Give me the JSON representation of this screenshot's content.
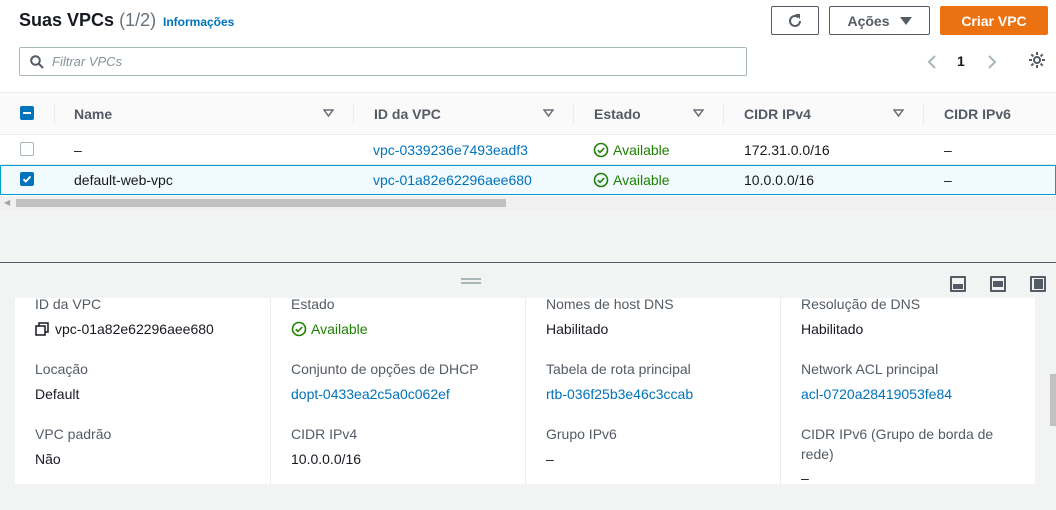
{
  "header": {
    "title": "Suas VPCs",
    "count": "(1/2)",
    "info_link": "Informações",
    "actions_label": "Ações",
    "create_label": "Criar VPC"
  },
  "filter": {
    "placeholder": "Filtrar VPCs"
  },
  "pagination": {
    "page": "1"
  },
  "table": {
    "columns": [
      "Name",
      "ID da VPC",
      "Estado",
      "CIDR IPv4",
      "CIDR IPv6"
    ],
    "rows": [
      {
        "name": "–",
        "vpc_id": "vpc-0339236e7493eadf3",
        "state": "Available",
        "cidr_ipv4": "172.31.0.0/16",
        "cidr_ipv6": "–",
        "selected": false
      },
      {
        "name": "default-web-vpc",
        "vpc_id": "vpc-01a82e62296aee680",
        "state": "Available",
        "cidr_ipv4": "10.0.0.0/16",
        "cidr_ipv6": "–",
        "selected": true
      }
    ]
  },
  "details": {
    "vpc_id_label": "ID da VPC",
    "vpc_id_value": "vpc-01a82e62296aee680",
    "state_label": "Estado",
    "state_value": "Available",
    "dns_hostnames_label": "Nomes de host DNS",
    "dns_hostnames_value": "Habilitado",
    "dns_resolution_label": "Resolução de DNS",
    "dns_resolution_value": "Habilitado",
    "tenancy_label": "Locação",
    "tenancy_value": "Default",
    "dhcp_label": "Conjunto de opções de DHCP",
    "dhcp_value": "dopt-0433ea2c5a0c062ef",
    "route_table_label": "Tabela de rota principal",
    "route_table_value": "rtb-036f25b3e46c3ccab",
    "acl_label": "Network ACL principal",
    "acl_value": "acl-0720a28419053fe84",
    "default_vpc_label": "VPC padrão",
    "default_vpc_value": "Não",
    "cidr_ipv4_label": "CIDR IPv4",
    "cidr_ipv4_value": "10.0.0.0/16",
    "ipv6_pool_label": "Grupo IPv6",
    "ipv6_pool_value": "–",
    "cidr_ipv6_border_label_1": "CIDR IPv6 (Grupo de borda de",
    "cidr_ipv6_border_label_2": "rede)",
    "cidr_ipv6_border_value": "–"
  },
  "colors": {
    "accent": "#ec7211",
    "link": "#0073bb",
    "success": "#1d8102",
    "selected_border": "#00a1c9"
  },
  "icons": [
    "refresh-icon",
    "caret-down-icon",
    "search-icon",
    "chevron-left-icon",
    "chevron-right-icon",
    "gear-icon",
    "sort-icon",
    "status-check-icon",
    "copy-icon",
    "layout-icons"
  ]
}
